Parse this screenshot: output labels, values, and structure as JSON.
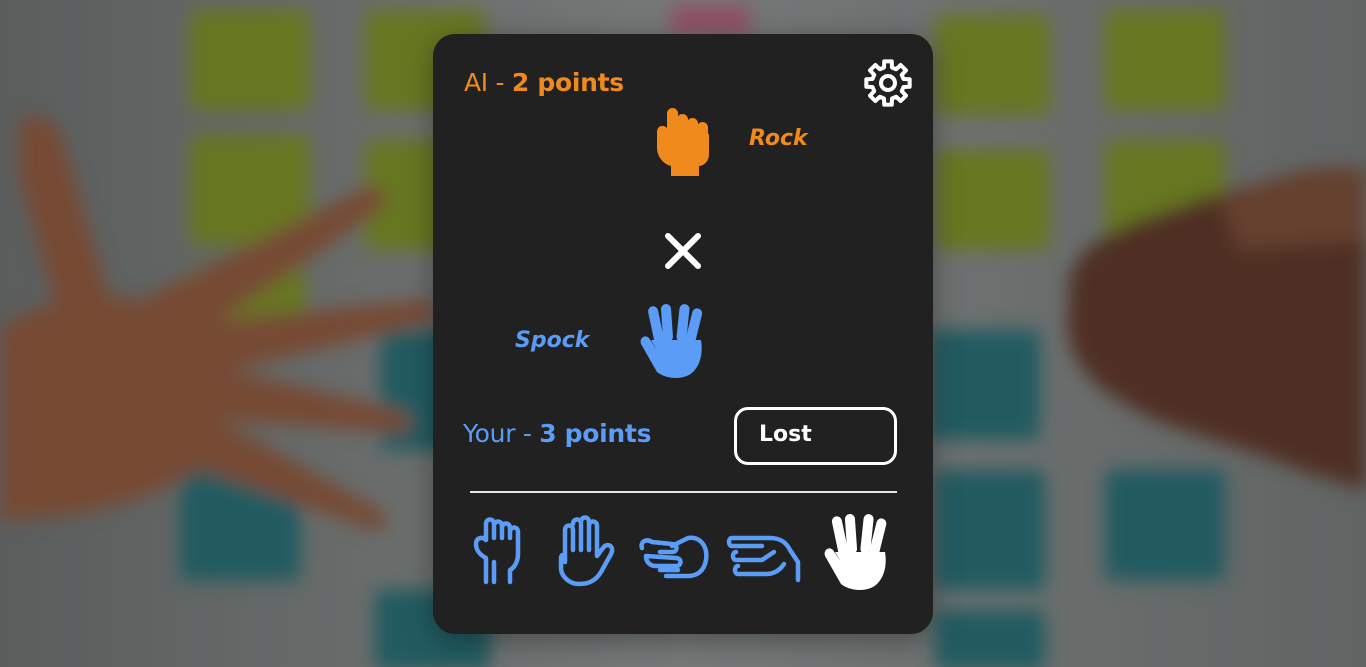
{
  "ai": {
    "label": "AI",
    "separator": " - ",
    "points_text": "2 points",
    "choice_label": "Rock",
    "choice_icon": "fist-icon",
    "color": "#f08a1c"
  },
  "player": {
    "label": "Your",
    "separator": " - ",
    "points_text": "3 points",
    "choice_label": "Spock",
    "choice_icon": "vulcan-salute-icon",
    "color": "#5b9cf6"
  },
  "result": {
    "text": "Lost"
  },
  "vs_icon": "close-x-icon",
  "settings_icon": "gear-icon",
  "choices": [
    {
      "name": "rock",
      "icon": "fist-icon",
      "selected": false
    },
    {
      "name": "paper",
      "icon": "open-hand-icon",
      "selected": false
    },
    {
      "name": "scissors",
      "icon": "scissors-hand-icon",
      "selected": false
    },
    {
      "name": "lizard",
      "icon": "lizard-hand-icon",
      "selected": false
    },
    {
      "name": "spock",
      "icon": "vulcan-salute-icon",
      "selected": true
    }
  ],
  "colors": {
    "card_background": "#212121",
    "choice_outline": "#5b9cf6",
    "selected_choice": "#ffffff"
  }
}
